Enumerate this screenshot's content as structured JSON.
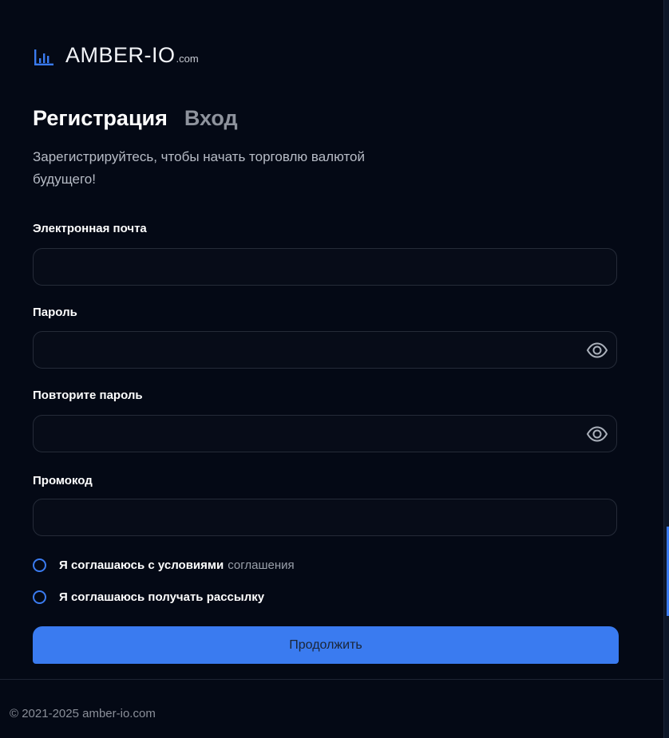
{
  "brand": {
    "name": "AMBER-IO",
    "suffix": ".com",
    "icon": "bar-chart-icon",
    "accent_color": "#3a7bf0"
  },
  "tabs": [
    {
      "label": "Регистрация",
      "active": true
    },
    {
      "label": "Вход",
      "active": false
    }
  ],
  "subtitle": "Зарегистрируйтесь, чтобы начать торговлю валютой будущего!",
  "form": {
    "email": {
      "label": "Электронная почта",
      "value": "",
      "placeholder": ""
    },
    "password": {
      "label": "Пароль",
      "value": "",
      "placeholder": "",
      "icon": "eye-icon"
    },
    "password_repeat": {
      "label": "Повторите пароль",
      "value": "",
      "placeholder": "",
      "icon": "eye-icon"
    },
    "promo": {
      "label": "Промокод",
      "value": "",
      "placeholder": ""
    },
    "agree_terms": {
      "label": "Я соглашаюсь с условиями",
      "link": "соглашения",
      "checked": false
    },
    "agree_newsletter": {
      "label": "Я соглашаюсь получать рассылку",
      "checked": false
    },
    "submit_label": "Продолжить"
  },
  "footer": {
    "copyright": "© 2021-2025 amber-io.com"
  }
}
